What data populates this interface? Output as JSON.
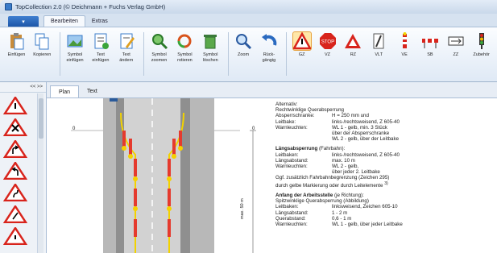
{
  "window": {
    "title": "TopCollection 2.0 (© Deichmann + Fuchs Verlag GmbH)"
  },
  "ribbon_tabs": [
    "Bearbeiten",
    "Extras"
  ],
  "toolbar": [
    {
      "id": "einfuegen",
      "label": "Einfügen",
      "icon": "paste-icon"
    },
    {
      "id": "kopieren",
      "label": "Kopieren",
      "icon": "copy-icon"
    },
    {
      "id": "symbol_einfuegen",
      "label": "Symbol\neinfügen",
      "icon": "image-insert-icon"
    },
    {
      "id": "text_einfuegen",
      "label": "Text\neinfügen",
      "icon": "text-insert-icon"
    },
    {
      "id": "text_aendern",
      "label": "Text\nändern",
      "icon": "text-edit-icon"
    },
    {
      "id": "symbol_zoomen",
      "label": "Symbol\nzoomen",
      "icon": "zoom-symbol-icon"
    },
    {
      "id": "symbol_rotieren",
      "label": "Symbol\nrotieren",
      "icon": "rotate-icon"
    },
    {
      "id": "symbol_loeschen",
      "label": "Symbol\nlöschen",
      "icon": "delete-icon"
    },
    {
      "id": "zoom",
      "label": "Zoom",
      "icon": "magnifier-icon"
    },
    {
      "id": "undo",
      "label": "Rück-\ngängig",
      "icon": "undo-icon"
    },
    {
      "id": "gz",
      "label": "GZ",
      "icon": "warning-sign-icon"
    },
    {
      "id": "vz",
      "label": "VZ",
      "icon": "stop-sign-icon"
    },
    {
      "id": "rz",
      "label": "RZ",
      "icon": "triangle-sign-icon"
    },
    {
      "id": "vlt",
      "label": "VLT",
      "icon": "lane-sign-icon"
    },
    {
      "id": "ve",
      "label": "VE",
      "icon": "bake-icon"
    },
    {
      "id": "sb",
      "label": "SB",
      "icon": "barrier-icon"
    },
    {
      "id": "zz",
      "label": "ZZ",
      "icon": "supplementary-sign-icon"
    },
    {
      "id": "zubehoer",
      "label": "Zubehör",
      "icon": "signal-light-icon"
    }
  ],
  "left_panel": {
    "nav": "<< >>"
  },
  "doc_tabs": [
    "Plan",
    "Text"
  ],
  "plan": {
    "left_mark": "0",
    "right_mark": "0",
    "dimension_label": "max. 50 m"
  },
  "notes": {
    "intro": "Alternativ:",
    "intro2": "Rechtwinklige Querabsperrung",
    "rows1": [
      {
        "k": "Absperrschranke:",
        "v": "H = 250 mm und"
      },
      {
        "k": "Leitbake:",
        "v": "links-/rechtsweisend, Z 605-40"
      },
      {
        "k": "Warnleuchten:",
        "v": "WL 1 - gelb, min. 3 Stück"
      },
      {
        "k": "",
        "v": "über der Absperrschranke"
      },
      {
        "k": "",
        "v": "WL 2 - gelb, über der Leitbake"
      }
    ],
    "head2": "Längsabsperrung",
    "head2_sub": " (Fahrbahn):",
    "rows2": [
      {
        "k": "Leitbaken:",
        "v": "links-/rechtsweisend, Z 605-40"
      },
      {
        "k": "Längsabstand:",
        "v": "max. 10 m"
      },
      {
        "k": "Warnleuchten:",
        "v": "WL 2 - gelb,"
      },
      {
        "k": "",
        "v": "über jeder 2. Leitbake"
      }
    ],
    "text2a": "Ggf. zusätzlich Fahrbahnbegrenzung (Zeichen 295)",
    "text2b": "durch gelbe Markierung oder durch Leitelemente ",
    "footnote": "3)",
    "head3": "Anfang der Arbeitsstelle",
    "head3_sub": " (je Richtung):",
    "text3": "Spitzwinklige Querabsperrung (Abbildung)",
    "rows3": [
      {
        "k": "Leitbaken:",
        "v": "linksweisend, Zeichen 605-10"
      },
      {
        "k": "Längsabstand:",
        "v": "1 - 2 m"
      },
      {
        "k": "Querabstand:",
        "v": "0,6 - 1 m"
      },
      {
        "k": "Warnleuchten:",
        "v": "WL 1 - gelb, über jeder Leitbake"
      }
    ]
  },
  "colors": {
    "accent": "#1d56a8",
    "sign_red": "#d8241c",
    "line_yellow": "#f2d200"
  }
}
